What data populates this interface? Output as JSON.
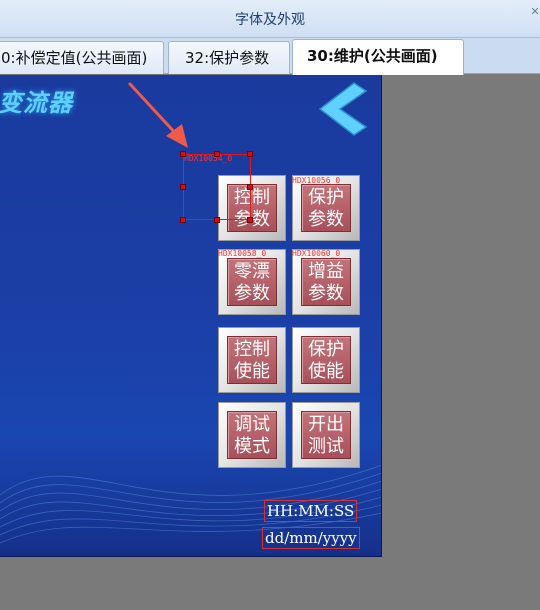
{
  "window": {
    "title": "字体及外观"
  },
  "tabs": [
    {
      "label": "0:补偿定值(公共画面)",
      "active": false
    },
    {
      "label": "32:保护参数",
      "active": false
    },
    {
      "label": "30:维护(公共画面)",
      "active": true
    }
  ],
  "screen": {
    "logo_text": "变流器",
    "buttons": [
      {
        "line1": "控制",
        "line2": "参数",
        "tag": "HDX10054_0"
      },
      {
        "line1": "保护",
        "line2": "参数",
        "tag": "HDX10056_0"
      },
      {
        "line1": "零漂",
        "line2": "参数",
        "tag": "HDX10058_0"
      },
      {
        "line1": "增益",
        "line2": "参数",
        "tag": "HDX10060_0"
      },
      {
        "line1": "控制",
        "line2": "使能",
        "tag": ""
      },
      {
        "line1": "保护",
        "line2": "使能",
        "tag": ""
      },
      {
        "line1": "调试",
        "line2": "模式",
        "tag": ""
      },
      {
        "line1": "开出",
        "line2": "测试",
        "tag": ""
      }
    ],
    "time_format": "HH:MM:SS",
    "date_format": "dd/mm/yyyy"
  },
  "colors": {
    "screen_bg": "#1a3a9e",
    "button_face": "#b45a63",
    "accent_cyan": "#5fd0ff",
    "selection": "#e01818"
  }
}
